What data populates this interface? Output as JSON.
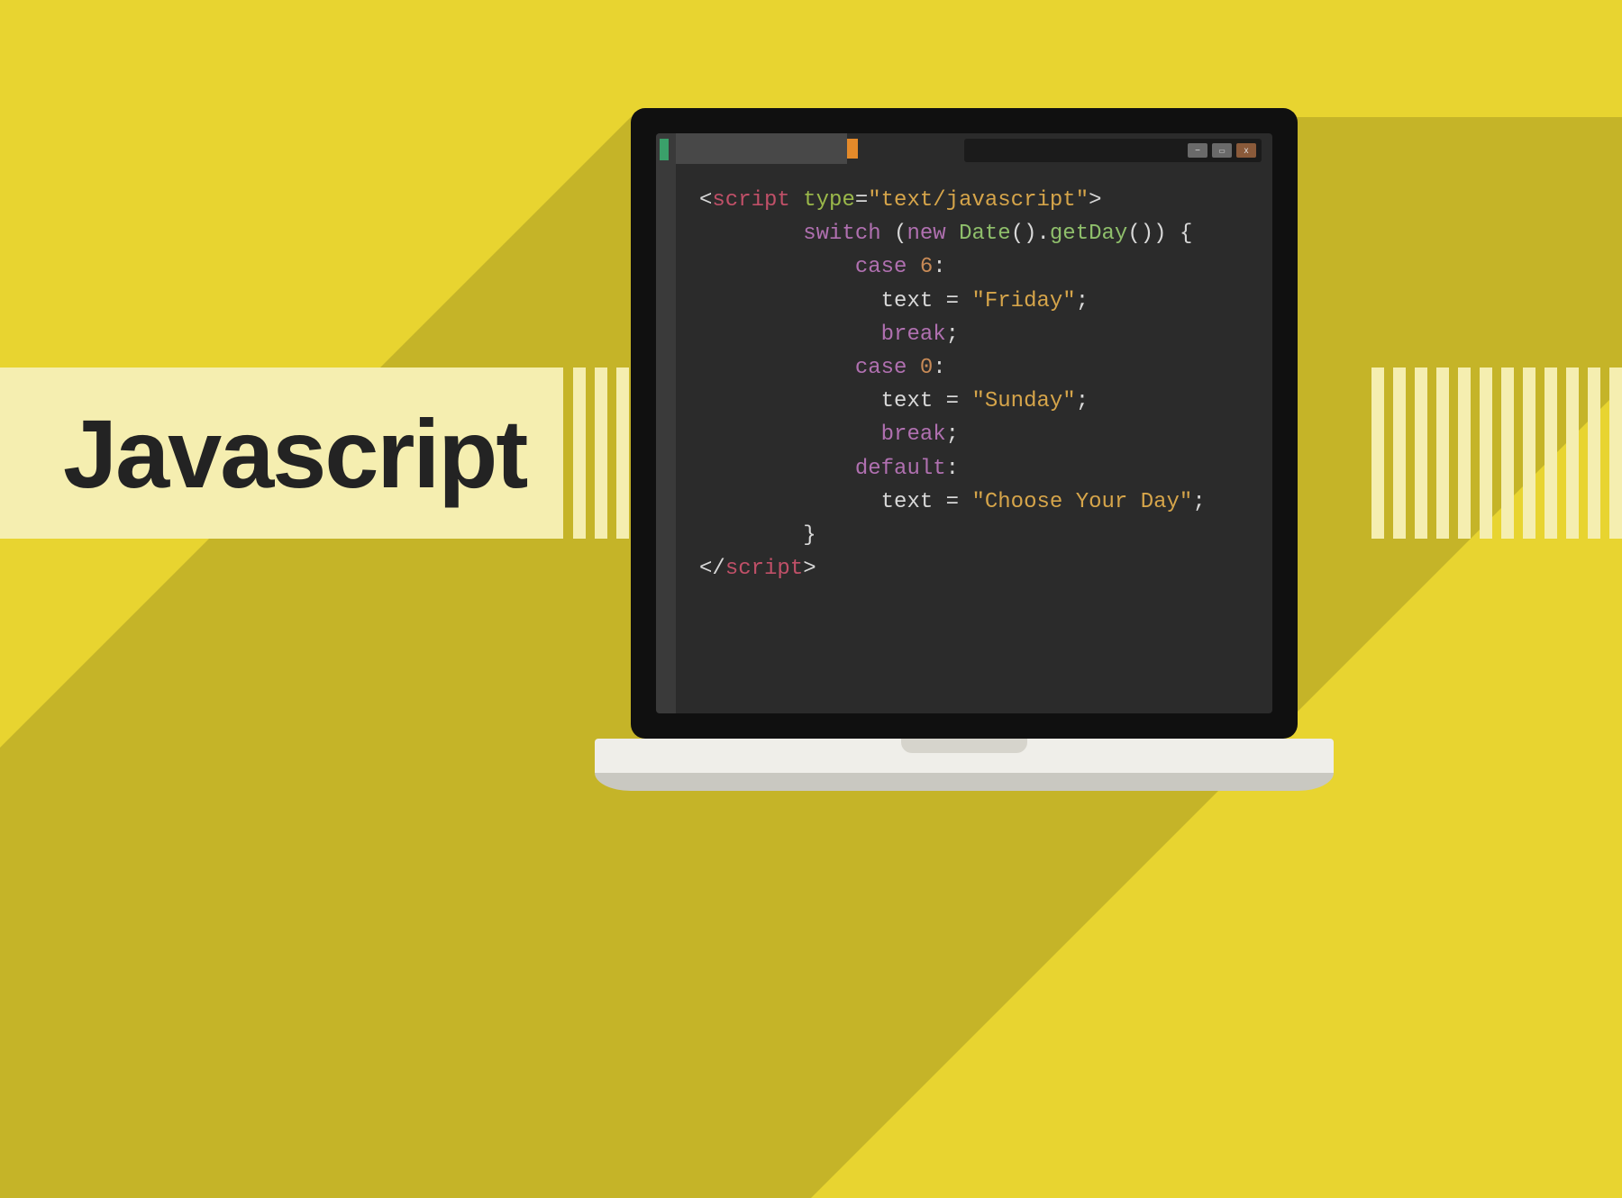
{
  "label": "Javascript",
  "code": {
    "l1_open": "<",
    "l1_tag": "script",
    "l1_sp": " ",
    "l1_attr": "type",
    "l1_eq": "=",
    "l1_str": "\"text/javascript\"",
    "l1_close": ">",
    "l2_pad": "        ",
    "l2_kw": "switch",
    "l2_sp": " (",
    "l2_new": "new",
    "l2_sp2": " ",
    "l2_fn1": "Date",
    "l2_p1": "().",
    "l2_fn2": "getDay",
    "l2_p2": "()) {",
    "l3_pad": "            ",
    "l3_kw": "case",
    "l3_sp": " ",
    "l3_num": "6",
    "l3_c": ":",
    "l4_pad": "              ",
    "l4_txt": "text = ",
    "l4_str": "\"Friday\"",
    "l4_sc": ";",
    "l5_pad": "              ",
    "l5_kw": "break",
    "l5_sc": ";",
    "l6_pad": "            ",
    "l6_kw": "case",
    "l6_sp": " ",
    "l6_num": "0",
    "l6_c": ":",
    "l7_pad": "              ",
    "l7_txt": "text = ",
    "l7_str": "\"Sunday\"",
    "l7_sc": ";",
    "l8_pad": "              ",
    "l8_kw": "break",
    "l8_sc": ";",
    "l9_pad": "            ",
    "l9_kw": "default",
    "l9_c": ":",
    "l10_pad": "              ",
    "l10_txt": "text = ",
    "l10_str": "\"Choose Your Day\"",
    "l10_sc": ";",
    "l11_pad": "        ",
    "l11_cb": "}",
    "l12_open": "</",
    "l12_tag": "script",
    "l12_close": ">"
  }
}
